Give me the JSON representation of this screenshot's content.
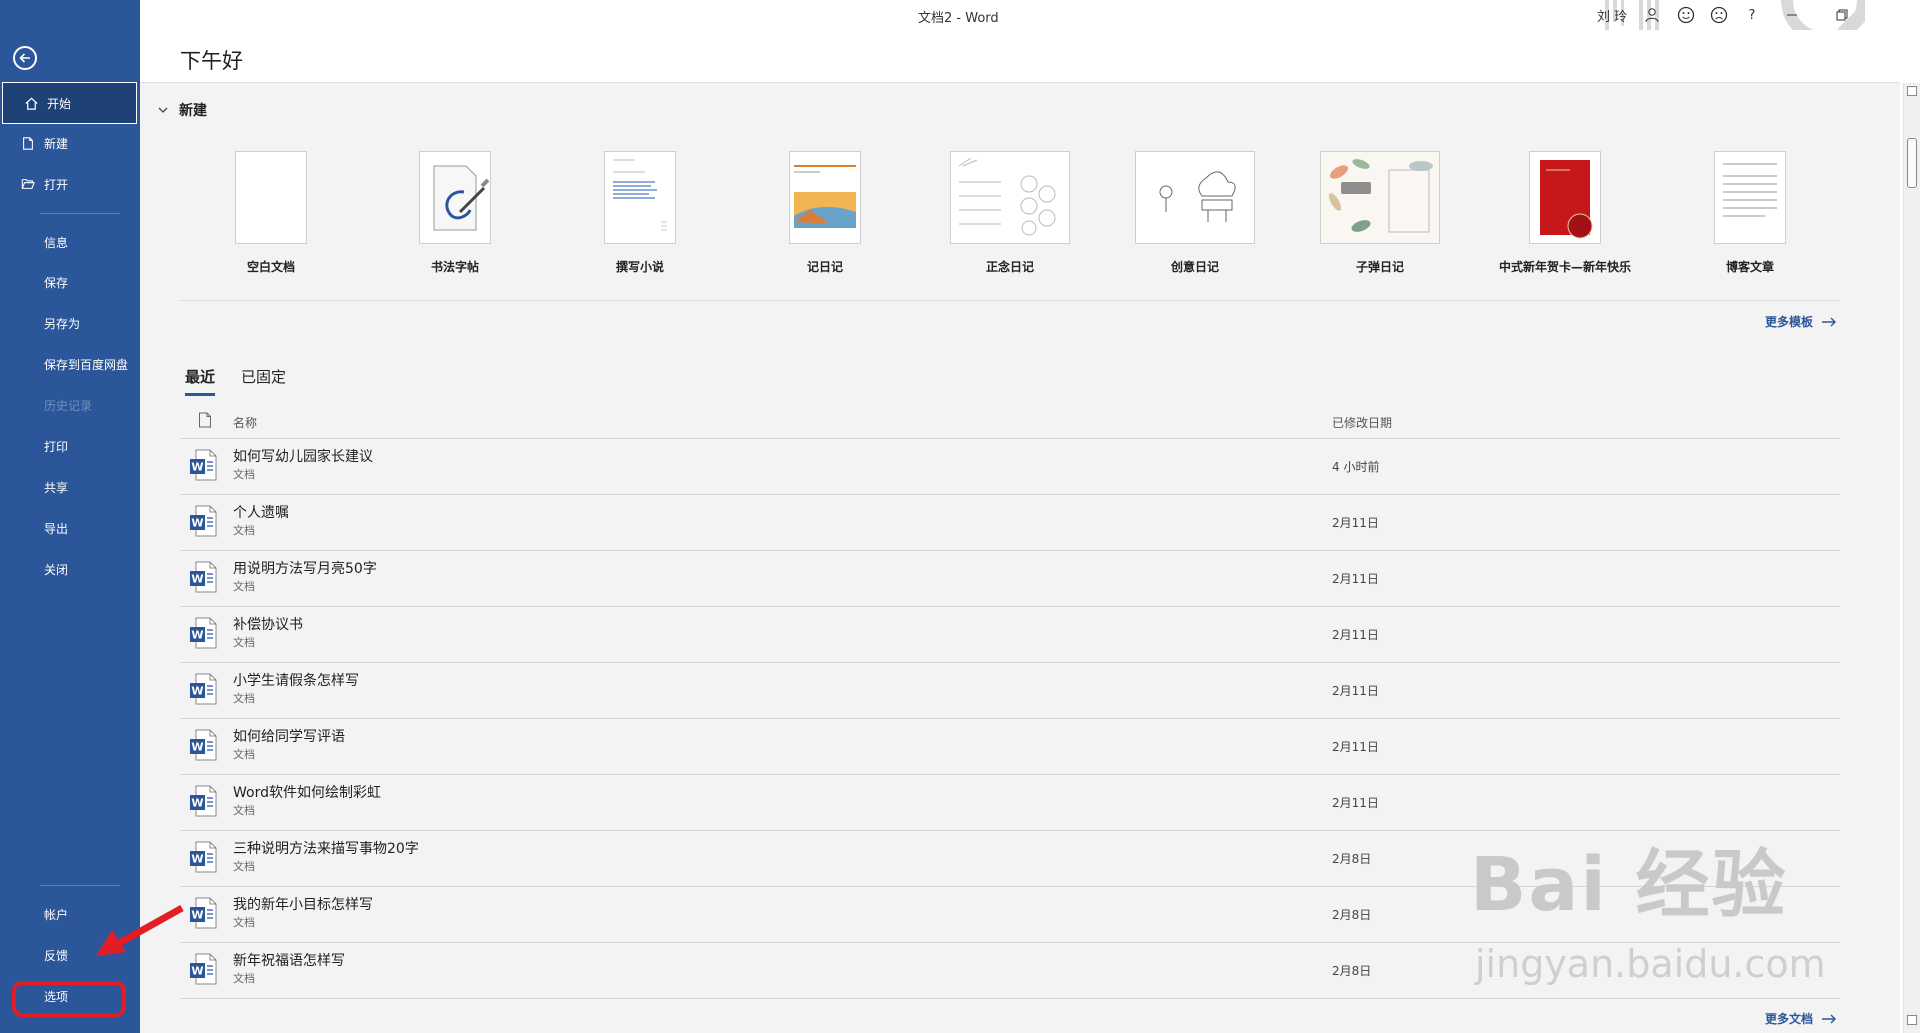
{
  "titlebar": {
    "doc_title": "文档2 - Word",
    "user_name": "刘 玲",
    "icons": [
      "user-icon",
      "smile-icon",
      "frown-icon",
      "help-icon",
      "minimize-icon",
      "restore-icon"
    ],
    "help_label": "?"
  },
  "sidebar": {
    "back_icon": "back-arrow-icon",
    "items": {
      "home": "开始",
      "new": "新建",
      "open": "打开",
      "info": "信息",
      "save": "保存",
      "save_as": "另存为",
      "save_baidu": "保存到百度网盘",
      "history": "历史记录",
      "print": "打印",
      "share": "共享",
      "export": "导出",
      "close": "关闭",
      "account": "帐户",
      "feedback": "反馈",
      "options": "选项"
    },
    "colors": {
      "bg": "#2b579a",
      "active_bg": "#1e4275",
      "highlight": "#e21d24"
    }
  },
  "main": {
    "greeting": "下午好",
    "new_section_label": "新建",
    "templates": [
      {
        "name": "空白文档"
      },
      {
        "name": "书法字帖"
      },
      {
        "name": "撰写小说"
      },
      {
        "name": "记日记"
      },
      {
        "name": "正念日记"
      },
      {
        "name": "创意日记"
      },
      {
        "name": "子弹日记"
      },
      {
        "name": "中式新年贺卡—新年快乐"
      },
      {
        "name": "博客文章"
      }
    ],
    "more_templates": "更多模板",
    "tabs": {
      "recent": "最近",
      "pinned": "已固定"
    },
    "list_headers": {
      "name": "名称",
      "modified": "已修改日期"
    },
    "files": [
      {
        "name": "如何写幼儿园家长建议",
        "type": "文档",
        "date": "4 小时前"
      },
      {
        "name": "个人遗嘱",
        "type": "文档",
        "date": "2月11日"
      },
      {
        "name": "用说明方法写月亮50字",
        "type": "文档",
        "date": "2月11日"
      },
      {
        "name": "补偿协议书",
        "type": "文档",
        "date": "2月11日"
      },
      {
        "name": "小学生请假条怎样写",
        "type": "文档",
        "date": "2月11日"
      },
      {
        "name": "如何给同学写评语",
        "type": "文档",
        "date": "2月11日"
      },
      {
        "name": "Word软件如何绘制彩虹",
        "type": "文档",
        "date": "2月11日"
      },
      {
        "name": "三种说明方法来描写事物20字",
        "type": "文档",
        "date": "2月8日"
      },
      {
        "name": "我的新年小目标怎样写",
        "type": "文档",
        "date": "2月8日"
      },
      {
        "name": "新年祝福语怎样写",
        "type": "文档",
        "date": "2月8日"
      }
    ],
    "more_documents": "更多文档"
  },
  "watermark": {
    "line1": "Bai 经验",
    "line2": "jingyan.baidu.com"
  }
}
